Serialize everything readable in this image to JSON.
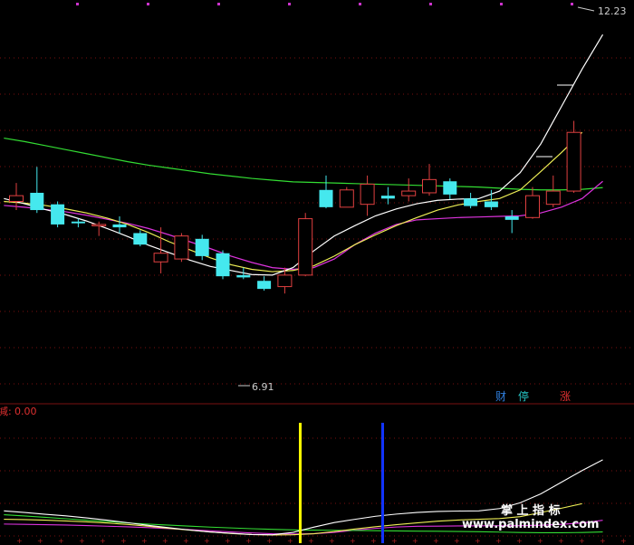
{
  "chart_data": {
    "type": "candlestick",
    "price_high_label": "12.23",
    "price_low_label": "6.91",
    "indicator_label": "0.00",
    "indicator_prefix": "减:",
    "badges": [
      {
        "text": "财",
        "color": "#2f7fdf"
      },
      {
        "text": "停",
        "color": "#26c6c6"
      },
      {
        "text": "涨",
        "color": "#e03030"
      }
    ],
    "watermark_cn": "掌 上 指 标",
    "watermark_url": "www.palmindex.com",
    "ylim": [
      5.6,
      12.6
    ],
    "colors": {
      "up": "#e04040",
      "down": "#45e8ee",
      "ma_white": "#ffffff",
      "ma_yellow": "#eeee55",
      "ma_magenta": "#dd33dd",
      "ma_green": "#33dd33",
      "grid": "#7a1010",
      "vbar_yellow": "#ffff00",
      "vbar_blue": "#1133ff"
    },
    "candles": [
      {
        "o": 9.1,
        "h": 9.42,
        "l": 8.95,
        "c": 9.2
      },
      {
        "o": 9.25,
        "h": 9.7,
        "l": 8.9,
        "c": 8.95
      },
      {
        "o": 9.05,
        "h": 9.1,
        "l": 8.65,
        "c": 8.7
      },
      {
        "o": 8.75,
        "h": 8.8,
        "l": 8.65,
        "c": 8.72
      },
      {
        "o": 8.7,
        "h": 8.75,
        "l": 8.5,
        "c": 8.7
      },
      {
        "o": 8.7,
        "h": 8.84,
        "l": 8.55,
        "c": 8.65
      },
      {
        "o": 8.55,
        "h": 8.6,
        "l": 8.32,
        "c": 8.35
      },
      {
        "o": 8.05,
        "h": 8.65,
        "l": 7.85,
        "c": 8.2
      },
      {
        "o": 8.1,
        "h": 8.55,
        "l": 8.05,
        "c": 8.5
      },
      {
        "o": 8.45,
        "h": 8.52,
        "l": 8.08,
        "c": 8.15
      },
      {
        "o": 8.2,
        "h": 8.25,
        "l": 7.75,
        "c": 7.8
      },
      {
        "o": 7.82,
        "h": 7.95,
        "l": 7.75,
        "c": 7.78
      },
      {
        "o": 7.72,
        "h": 7.8,
        "l": 7.55,
        "c": 7.58
      },
      {
        "o": 7.62,
        "h": 7.95,
        "l": 7.5,
        "c": 7.82
      },
      {
        "o": 7.82,
        "h": 8.9,
        "l": 7.8,
        "c": 8.8
      },
      {
        "o": 9.3,
        "h": 9.55,
        "l": 8.98,
        "c": 9.0
      },
      {
        "o": 9.0,
        "h": 9.35,
        "l": 9.0,
        "c": 9.3
      },
      {
        "o": 9.05,
        "h": 9.55,
        "l": 8.85,
        "c": 9.4
      },
      {
        "o": 9.2,
        "h": 9.35,
        "l": 9.05,
        "c": 9.15
      },
      {
        "o": 9.2,
        "h": 9.5,
        "l": 9.1,
        "c": 9.28
      },
      {
        "o": 9.25,
        "h": 9.75,
        "l": 9.2,
        "c": 9.48
      },
      {
        "o": 9.45,
        "h": 9.5,
        "l": 9.14,
        "c": 9.22
      },
      {
        "o": 9.15,
        "h": 9.25,
        "l": 8.98,
        "c": 9.02
      },
      {
        "o": 9.1,
        "h": 9.3,
        "l": 8.95,
        "c": 9.0
      },
      {
        "o": 8.84,
        "h": 8.95,
        "l": 8.55,
        "c": 8.78
      },
      {
        "o": 8.82,
        "h": 9.35,
        "l": 8.8,
        "c": 9.2
      },
      {
        "o": 9.05,
        "h": 9.55,
        "l": 9.0,
        "c": 9.28
      },
      {
        "o": 9.28,
        "h": 10.5,
        "l": 9.25,
        "c": 10.3
      }
    ],
    "ma_white": [
      9.15,
      9.06,
      8.96,
      8.87,
      8.76,
      8.63,
      8.49,
      8.34,
      8.21,
      8.08,
      7.97,
      7.9,
      7.83,
      7.82,
      7.95,
      8.24,
      8.5,
      8.68,
      8.85,
      8.97,
      9.06,
      9.12,
      9.14,
      9.15,
      9.28,
      9.6,
      10.1,
      10.75,
      11.4,
      12.0
    ],
    "ma_yellow": [
      9.1,
      9.07,
      9.03,
      8.97,
      8.9,
      8.81,
      8.7,
      8.56,
      8.4,
      8.26,
      8.12,
      8.0,
      7.92,
      7.88,
      7.9,
      7.98,
      8.15,
      8.35,
      8.52,
      8.68,
      8.82,
      8.95,
      9.04,
      9.1,
      9.15,
      9.3,
      9.62,
      9.95,
      10.3
    ],
    "ma_magenta": [
      9.03,
      9.0,
      8.96,
      8.92,
      8.86,
      8.79,
      8.72,
      8.63,
      8.52,
      8.4,
      8.28,
      8.15,
      8.04,
      7.95,
      7.92,
      7.95,
      8.1,
      8.35,
      8.55,
      8.7,
      8.78,
      8.8,
      8.82,
      8.83,
      8.84,
      8.85,
      8.9,
      9.0,
      9.15,
      9.45
    ],
    "ma_green": [
      10.2,
      10.14,
      10.07,
      10.0,
      9.93,
      9.86,
      9.79,
      9.73,
      9.68,
      9.63,
      9.58,
      9.54,
      9.5,
      9.47,
      9.44,
      9.43,
      9.42,
      9.41,
      9.4,
      9.39,
      9.38,
      9.37,
      9.36,
      9.35,
      9.33,
      9.31,
      9.3,
      9.3,
      9.31,
      9.34
    ]
  }
}
